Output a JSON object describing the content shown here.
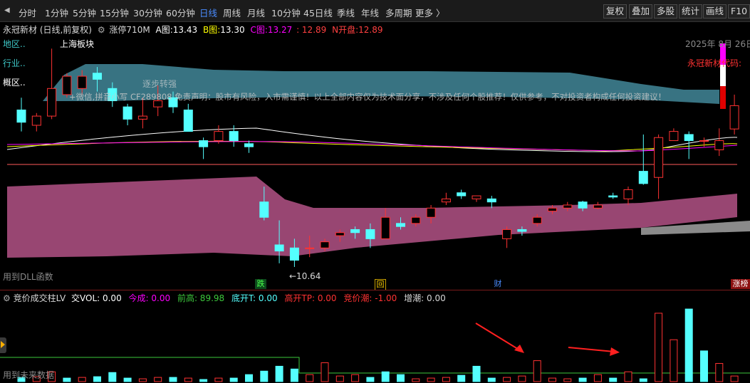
{
  "toolbar": {
    "periods": [
      "分时",
      "1分钟",
      "5分钟",
      "15分钟",
      "30分钟",
      "60分钟",
      "日线",
      "周线",
      "月线",
      "10分钟",
      "45日线",
      "季线",
      "年线",
      "多周期",
      "更多 〉"
    ],
    "active_period": "日线",
    "right_buttons": [
      "复权",
      "叠加",
      "多股",
      "统计",
      "画线",
      "F10"
    ]
  },
  "main_header": {
    "stock": "永冠新材 (日线,前复权)",
    "formula": "涨停710M",
    "a_label": "A图:",
    "a_value": "13.43",
    "b_label": "B图:",
    "b_value": "13.30",
    "c_label": "C图:",
    "c_value": "13.27",
    "c_extra": ": 12.89",
    "n_label": "N开盘:",
    "n_value": "12.89"
  },
  "overlay": {
    "region": "地区..",
    "industry": "行业..",
    "concept": "概区..",
    "hot_sector": "上海板块",
    "trend_note": "逐步转强",
    "disclaimer": "+微信,拼音小写  CF289808  免责声明：股市有风险，入市需谨慎！以上全部内容仅为技术面分享，不涉及任何个股推荐！仅供参考，不对投资者构成任何投资建议！",
    "date": "2025年 8月 26日",
    "stock_tag": "永冠新材",
    "code_tag": "代码:",
    "dll_note": "用到DLL函数",
    "low_price": "←10.64",
    "markers": [
      "跌",
      "回",
      "财",
      "涨榜"
    ]
  },
  "sub_header": {
    "title": "竞价成交柱LV",
    "vol": "交VOL: 0.00",
    "jincheng": "今成: 0.00",
    "qiangao": "前高: 89.98",
    "dikai": "底开T: 0.00",
    "gaokai": "高开TP: 0.00",
    "jingchao": "竞价潮: -1.00",
    "zengchao": "增潮: 0.00",
    "future_note": "用到未来数据"
  },
  "colors": {
    "up": "#ff3232",
    "down": "#54ffff",
    "upper_band": "#3e7f90",
    "lower_band": "#a04a78",
    "active": "#4a8cff",
    "sub_line": "#3cc83c",
    "magenta": "#ff00ff",
    "yellow": "#ffff00"
  },
  "candles": [
    {
      "o": 13.2,
      "h": 13.4,
      "c": 13.0,
      "l": 12.85
    },
    {
      "o": 12.95,
      "h": 13.15,
      "c": 13.1,
      "l": 12.85
    },
    {
      "o": 13.1,
      "h": 14.2,
      "c": 13.55,
      "l": 13.05
    },
    {
      "o": 13.45,
      "h": 13.8,
      "c": 13.75,
      "l": 13.4
    },
    {
      "o": 13.55,
      "h": 13.85,
      "c": 13.75,
      "l": 13.45
    },
    {
      "o": 13.8,
      "h": 13.9,
      "c": 13.7,
      "l": 13.5
    },
    {
      "o": 13.55,
      "h": 13.65,
      "c": 13.35,
      "l": 13.25
    },
    {
      "o": 13.25,
      "h": 13.3,
      "c": 13.05,
      "l": 12.95
    },
    {
      "o": 13.05,
      "h": 13.4,
      "c": 13.1,
      "l": 12.9
    },
    {
      "o": 13.25,
      "h": 13.6,
      "c": 13.35,
      "l": 13.1
    },
    {
      "o": 13.4,
      "h": 13.5,
      "c": 13.25,
      "l": 13.15
    },
    {
      "o": 13.2,
      "h": 13.3,
      "c": 12.85,
      "l": 12.85
    },
    {
      "o": 12.7,
      "h": 12.75,
      "c": 12.6,
      "l": 12.4
    },
    {
      "o": 12.7,
      "h": 12.95,
      "c": 12.85,
      "l": 12.65
    },
    {
      "o": 12.85,
      "h": 12.95,
      "c": 12.7,
      "l": 12.6
    },
    {
      "o": 12.65,
      "h": 12.7,
      "c": 12.6,
      "l": 12.5
    },
    {
      "o": 11.7,
      "h": 11.95,
      "c": 11.45,
      "l": 11.4
    },
    {
      "o": 11.0,
      "h": 11.4,
      "c": 10.9,
      "l": 10.7
    },
    {
      "o": 10.95,
      "h": 11.1,
      "c": 10.75,
      "l": 10.64
    },
    {
      "o": 10.95,
      "h": 11.15,
      "c": 10.95,
      "l": 10.8
    },
    {
      "o": 10.95,
      "h": 11.1,
      "c": 11.05,
      "l": 10.9
    },
    {
      "o": 11.15,
      "h": 11.25,
      "c": 11.2,
      "l": 11.05
    },
    {
      "o": 11.25,
      "h": 11.3,
      "c": 11.2,
      "l": 11.1
    },
    {
      "o": 11.25,
      "h": 11.35,
      "c": 11.1,
      "l": 10.95
    },
    {
      "o": 11.1,
      "h": 11.6,
      "c": 11.45,
      "l": 11.1
    },
    {
      "o": 11.35,
      "h": 11.45,
      "c": 11.3,
      "l": 11.25
    },
    {
      "o": 11.35,
      "h": 11.5,
      "c": 11.45,
      "l": 11.3
    },
    {
      "o": 11.45,
      "h": 11.65,
      "c": 11.6,
      "l": 11.35
    },
    {
      "o": 11.7,
      "h": 11.85,
      "c": 11.75,
      "l": 11.65
    },
    {
      "o": 11.85,
      "h": 11.9,
      "c": 11.8,
      "l": 11.75
    },
    {
      "o": 11.75,
      "h": 11.8,
      "c": 11.8,
      "l": 11.7
    },
    {
      "o": 11.75,
      "h": 11.8,
      "c": 11.7,
      "l": 11.6
    },
    {
      "o": 11.1,
      "h": 11.3,
      "c": 11.25,
      "l": 10.95
    },
    {
      "o": 11.25,
      "h": 11.3,
      "c": 11.22,
      "l": 11.15
    },
    {
      "o": 11.35,
      "h": 11.5,
      "c": 11.45,
      "l": 11.3
    },
    {
      "o": 11.55,
      "h": 11.65,
      "c": 11.6,
      "l": 11.5
    },
    {
      "o": 11.6,
      "h": 11.7,
      "c": 11.65,
      "l": 11.55
    },
    {
      "o": 11.7,
      "h": 11.72,
      "c": 11.6,
      "l": 11.55
    },
    {
      "o": 11.6,
      "h": 11.7,
      "c": 11.65,
      "l": 11.58
    },
    {
      "o": 11.8,
      "h": 11.85,
      "c": 11.78,
      "l": 11.75
    },
    {
      "o": 11.75,
      "h": 11.95,
      "c": 11.9,
      "l": 11.65
    },
    {
      "o": 12.2,
      "h": 12.8,
      "c": 12.0,
      "l": 11.98
    },
    {
      "o": 12.1,
      "h": 12.8,
      "c": 12.75,
      "l": 11.75
    },
    {
      "o": 12.7,
      "h": 12.9,
      "c": 12.85,
      "l": 12.7
    },
    {
      "o": 12.8,
      "h": 12.85,
      "c": 12.7,
      "l": 12.4
    },
    {
      "o": 12.7,
      "h": 12.75,
      "c": 12.7,
      "l": 12.6
    },
    {
      "o": 12.55,
      "h": 12.9,
      "c": 12.7,
      "l": 12.45
    },
    {
      "o": 12.89,
      "h": 13.45,
      "c": 13.27,
      "l": 12.8
    }
  ],
  "volumes": [
    {
      "v": 6,
      "up": false
    },
    {
      "v": 7,
      "up": true
    },
    {
      "v": 14,
      "up": true
    },
    {
      "v": 5,
      "up": false
    },
    {
      "v": 6,
      "up": true
    },
    {
      "v": 7,
      "up": false
    },
    {
      "v": 13,
      "up": false
    },
    {
      "v": 5,
      "up": false
    },
    {
      "v": 4,
      "up": true
    },
    {
      "v": 6,
      "up": true
    },
    {
      "v": 6,
      "up": false
    },
    {
      "v": 5,
      "up": true
    },
    {
      "v": 3,
      "up": false
    },
    {
      "v": 5,
      "up": true
    },
    {
      "v": 5,
      "up": false
    },
    {
      "v": 10,
      "up": false
    },
    {
      "v": 15,
      "up": false
    },
    {
      "v": 22,
      "up": false
    },
    {
      "v": 18,
      "up": false
    },
    {
      "v": 10,
      "up": true
    },
    {
      "v": 27,
      "up": true
    },
    {
      "v": 8,
      "up": true
    },
    {
      "v": 10,
      "up": true
    },
    {
      "v": 6,
      "up": false
    },
    {
      "v": 14,
      "up": false
    },
    {
      "v": 10,
      "up": false
    },
    {
      "v": 4,
      "up": true
    },
    {
      "v": 5,
      "up": true
    },
    {
      "v": 6,
      "up": true
    },
    {
      "v": 9,
      "up": false
    },
    {
      "v": 22,
      "up": false
    },
    {
      "v": 5,
      "up": false
    },
    {
      "v": 6,
      "up": true
    },
    {
      "v": 8,
      "up": true
    },
    {
      "v": 30,
      "up": true
    },
    {
      "v": 5,
      "up": true
    },
    {
      "v": 4,
      "up": true
    },
    {
      "v": 5,
      "up": false
    },
    {
      "v": 10,
      "up": true
    },
    {
      "v": 5,
      "up": false
    },
    {
      "v": 14,
      "up": true
    },
    {
      "v": 4,
      "up": false
    },
    {
      "v": 98,
      "up": true
    },
    {
      "v": 60,
      "up": true
    },
    {
      "v": 104,
      "up": false
    },
    {
      "v": 44,
      "up": false
    },
    {
      "v": 26,
      "up": true
    },
    {
      "v": 8,
      "up": true
    }
  ],
  "sub_line_levels": [
    0.0,
    0.0
  ]
}
